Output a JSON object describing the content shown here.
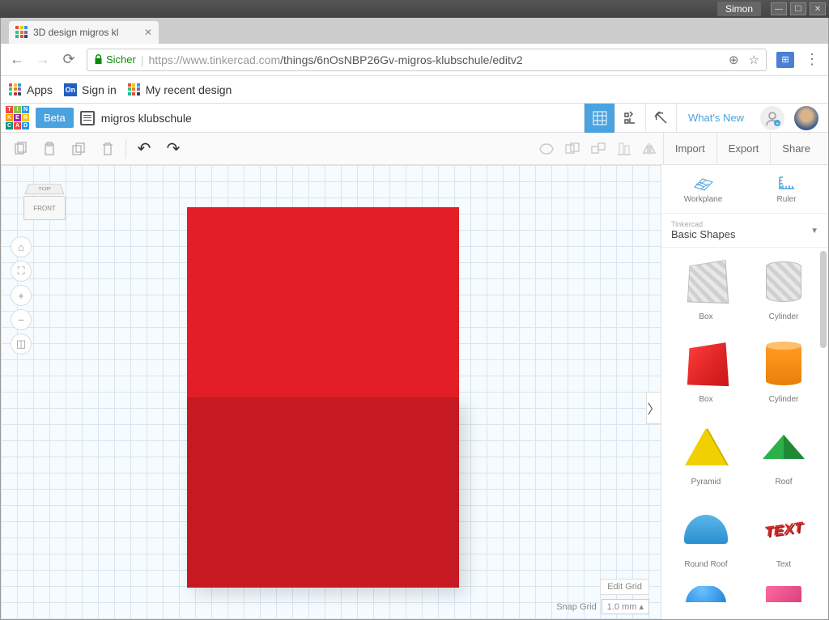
{
  "os": {
    "user": "Simon"
  },
  "tab": {
    "title": "3D design migros kl"
  },
  "url": {
    "secure_label": "Sicher",
    "host": "https://www.tinkercad.com",
    "path": "/things/6nOsNBP26Gv-migros-klubschule/editv2"
  },
  "bookmarks": {
    "apps": "Apps",
    "signin": "Sign in",
    "recent": "My recent design"
  },
  "header": {
    "beta": "Beta",
    "design_name": "migros klubschule",
    "whats_new": "What's New"
  },
  "toolbar": {
    "import": "Import",
    "export": "Export",
    "share": "Share"
  },
  "viewcube": {
    "top": "TOP",
    "front": "FRONT"
  },
  "grid": {
    "edit": "Edit Grid",
    "snap_label": "Snap Grid",
    "snap_value": "1.0 mm  ▴"
  },
  "sidepanel": {
    "workplane": "Workplane",
    "ruler": "Ruler",
    "category_sub": "Tinkercad",
    "category": "Basic Shapes",
    "shapes": [
      {
        "label": "Box",
        "kind": "striped-box"
      },
      {
        "label": "Cylinder",
        "kind": "striped-cyl"
      },
      {
        "label": "Box",
        "kind": "red-box"
      },
      {
        "label": "Cylinder",
        "kind": "orange-cyl"
      },
      {
        "label": "Pyramid",
        "kind": "pyramid"
      },
      {
        "label": "Roof",
        "kind": "roof"
      },
      {
        "label": "Round Roof",
        "kind": "roundroof"
      },
      {
        "label": "Text",
        "kind": "text3d"
      }
    ]
  }
}
